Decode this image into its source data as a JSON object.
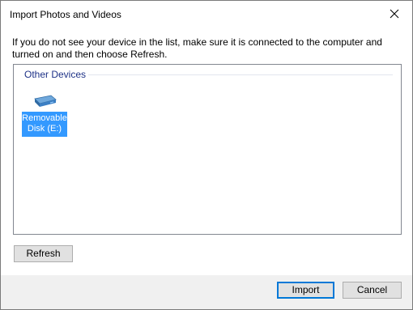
{
  "window": {
    "title": "Import Photos and Videos"
  },
  "message": "If you do not see your device in the list, make sure it is connected to the computer and turned on and then choose Refresh.",
  "device_list": {
    "group_header": "Other Devices",
    "devices": [
      {
        "label": "Removable Disk (E:)",
        "icon": "removable-disk-icon",
        "selected": true
      }
    ]
  },
  "buttons": {
    "refresh": "Refresh",
    "import": "Import",
    "cancel": "Cancel"
  },
  "colors": {
    "selection": "#3399ff",
    "group_header": "#1e3287",
    "accent_border": "#0078d7"
  }
}
